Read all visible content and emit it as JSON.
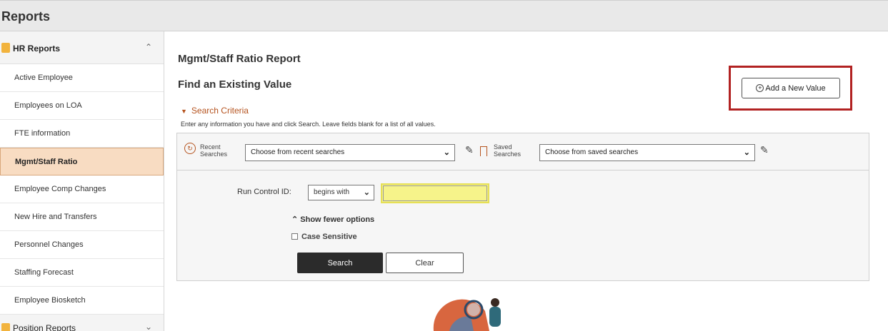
{
  "app": {
    "title": "Reports"
  },
  "sidebar": {
    "groups": [
      {
        "label": "HR Reports",
        "chevron": "^"
      },
      {
        "label": "Position Reports",
        "chevron": "v"
      }
    ],
    "items": [
      {
        "label": "Active Employee"
      },
      {
        "label": "Employees on LOA"
      },
      {
        "label": "FTE information"
      },
      {
        "label": "Mgmt/Staff Ratio",
        "active": true
      },
      {
        "label": "Employee Comp Changes"
      },
      {
        "label": "New Hire and Transfers"
      },
      {
        "label": "Personnel Changes"
      },
      {
        "label": "Staffing Forecast"
      },
      {
        "label": "Employee Biosketch"
      }
    ]
  },
  "main": {
    "page_title": "Mgmt/Staff Ratio Report",
    "find_title": "Find an Existing Value",
    "add_button": "Add a New Value",
    "search_criteria": "Search Criteria",
    "hint": "Enter any information you have and click Search. Leave fields blank for a list of all values.",
    "recent": {
      "label_top": "Recent",
      "label_bottom": "Searches",
      "placeholder": "Choose from recent searches"
    },
    "saved": {
      "label_top": "Saved",
      "label_bottom": "Searches",
      "placeholder": "Choose from saved searches"
    },
    "run_control_label": "Run Control ID:",
    "operator": "begins with",
    "run_control_value": "",
    "show_fewer": "Show fewer options",
    "case_sensitive": "Case Sensitive",
    "search_button": "Search",
    "clear_button": "Clear"
  },
  "colors": {
    "accent": "#b5531e",
    "highlight_frame": "#b22222",
    "active_item": "#f8dcc2",
    "input_highlight": "#f6f38a"
  }
}
